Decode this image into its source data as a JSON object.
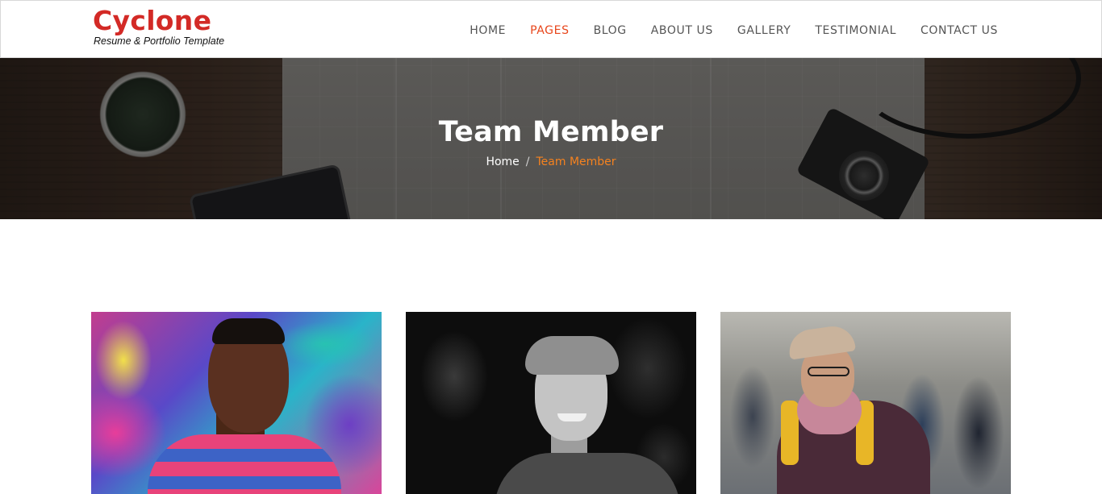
{
  "brand": {
    "title": "Cyclone",
    "tagline": "Resume & Portfolio Template",
    "accent_color": "#d32a26"
  },
  "nav": {
    "items": [
      {
        "label": "HOME",
        "active": false
      },
      {
        "label": "PAGES",
        "active": true
      },
      {
        "label": "BLOG",
        "active": false
      },
      {
        "label": "ABOUT US",
        "active": false
      },
      {
        "label": "GALLERY",
        "active": false
      },
      {
        "label": "TESTIMONIAL",
        "active": false
      },
      {
        "label": "CONTACT US",
        "active": false
      }
    ],
    "active_color": "#e8461b"
  },
  "banner": {
    "title": "Team Member",
    "breadcrumb": {
      "home": "Home",
      "separator": "/",
      "current": "Team Member"
    },
    "current_color": "#f5821f"
  },
  "team": {
    "members": [
      {
        "photo": "member-photo-graffiti"
      },
      {
        "photo": "member-photo-bw"
      },
      {
        "photo": "member-photo-street"
      }
    ]
  }
}
